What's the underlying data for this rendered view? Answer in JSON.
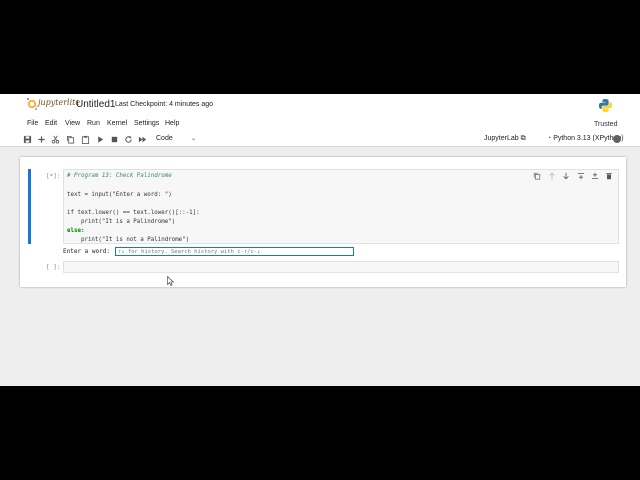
{
  "header": {
    "logo_text": "jupyterlite",
    "notebook_title": "Untitled1",
    "checkpoint": "Last Checkpoint: 4 minutes ago"
  },
  "menu": {
    "items": [
      "File",
      "Edit",
      "View",
      "Run",
      "Kernel",
      "Settings",
      "Help"
    ],
    "trusted": "Trusted"
  },
  "toolbar": {
    "icons": [
      "save-icon",
      "add-cell-icon",
      "cut-icon",
      "copy-icon",
      "paste-icon",
      "run-icon",
      "stop-icon",
      "restart-icon",
      "fast-forward-icon"
    ],
    "cell_type": "Code",
    "jupyterlab_link": "JupyterLab",
    "kernel_name": "Python 3.13 (XPython)"
  },
  "cells": [
    {
      "prompt": "[*]:",
      "lines": [
        "# Program 13: Check Palindrome",
        "",
        "text = input(\"Enter a word: \")",
        "",
        "if text.lower() == text.lower()[::-1]:",
        "    print(\"It is a Palindrome\")",
        "else:",
        "    print(\"It is not a Palindrome\")"
      ],
      "stdin": {
        "prompt": "Enter a word:",
        "placeholder": "↑↓ for history. Search history with c-↑/c-↓"
      }
    },
    {
      "prompt": "[ ]:"
    }
  ],
  "cell_actions": [
    "duplicate-icon",
    "move-up-icon",
    "move-down-icon",
    "insert-above-icon",
    "insert-below-icon",
    "delete-icon"
  ],
  "colors": {
    "accent": "#1976d2",
    "kernel_idle": "#616161",
    "background": "#eeeeee"
  }
}
